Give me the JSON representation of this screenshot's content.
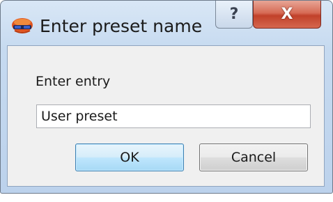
{
  "dialog": {
    "title": "Enter preset name",
    "help_label": "?",
    "close_label": "X"
  },
  "form": {
    "prompt_label": "Enter entry",
    "entry_value": "User preset"
  },
  "buttons": {
    "ok_label": "OK",
    "cancel_label": "Cancel"
  }
}
